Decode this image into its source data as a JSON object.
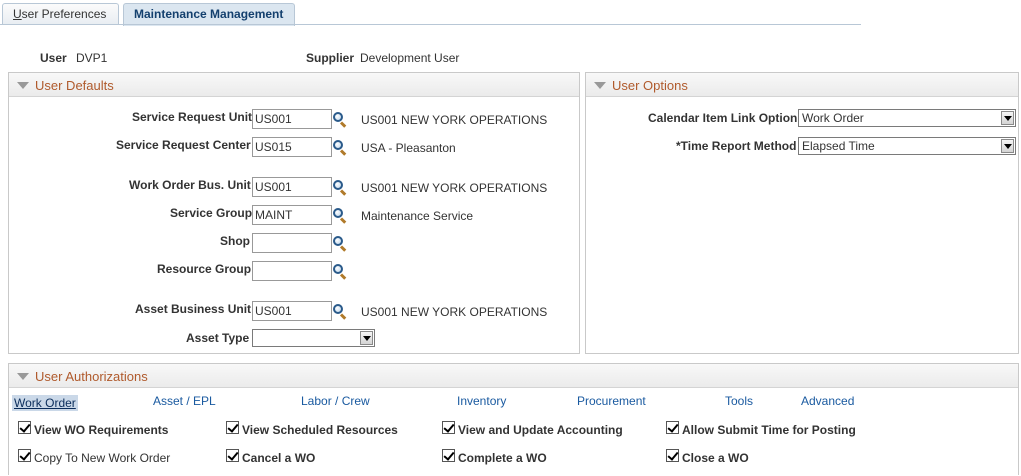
{
  "tabs": [
    {
      "label_u": "U",
      "label_rest": "ser Preferences"
    },
    {
      "label": "Maintenance Management"
    }
  ],
  "header": {
    "user_label": "User",
    "user_value": "DVP1",
    "supplier_label": "Supplier",
    "supplier_value": "Development User"
  },
  "user_defaults": {
    "title": "User Defaults",
    "service_request_unit": {
      "label": "Service Request Unit",
      "value": "US001",
      "desc": "US001 NEW YORK OPERATIONS"
    },
    "service_request_center": {
      "label": "Service Request Center",
      "value": "US015",
      "desc": "USA - Pleasanton"
    },
    "work_order_bu": {
      "label": "Work Order Bus. Unit",
      "value": "US001",
      "desc": "US001 NEW YORK OPERATIONS"
    },
    "service_group": {
      "label": "Service Group",
      "value": "MAINT",
      "desc": "Maintenance Service"
    },
    "shop": {
      "label": "Shop",
      "value": ""
    },
    "resource_group": {
      "label": "Resource Group",
      "value": ""
    },
    "asset_bu": {
      "label": "Asset Business Unit",
      "value": "US001",
      "desc": "US001 NEW YORK OPERATIONS"
    },
    "asset_type": {
      "label": "Asset Type",
      "value": ""
    }
  },
  "user_options": {
    "title": "User Options",
    "calendar_link": {
      "label": "Calendar Item Link Option",
      "value": "Work Order"
    },
    "time_report": {
      "label": "*Time Report Method",
      "value": "Elapsed Time"
    }
  },
  "authorizations": {
    "title": "User Authorizations",
    "links": [
      "Work Order",
      "Asset / EPL",
      "Labor / Crew",
      "Inventory",
      "Procurement",
      "Tools",
      "Advanced"
    ],
    "checks": [
      "View WO Requirements",
      "View Scheduled Resources",
      "View and Update Accounting",
      "Allow Submit Time for Posting",
      "Copy To New Work Order",
      "Cancel a WO",
      "Complete a WO",
      "Close a WO"
    ]
  },
  "icons": {
    "lookup": "magnifier-icon",
    "collapse": "collapse-triangle-icon",
    "dropdown": "dropdown-arrow-icon",
    "check": "checkbox-checked-icon"
  },
  "colors": {
    "group_title": "#b05a2c",
    "link": "#1a5aa0",
    "active_tab": "#dbe6f0"
  }
}
